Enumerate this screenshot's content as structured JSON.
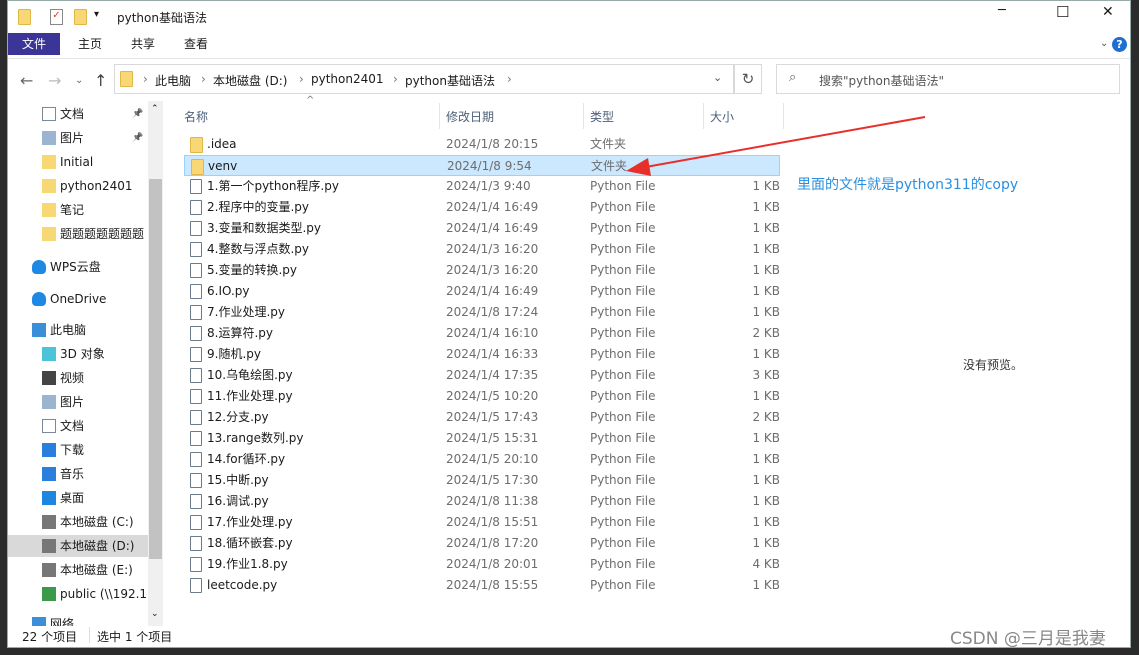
{
  "window": {
    "title": "python基础语法",
    "minimize": "─",
    "maximize": "☐",
    "close": "✕"
  },
  "ribbon": {
    "tabs": [
      "文件",
      "主页",
      "共享",
      "查看"
    ],
    "active": 0,
    "accent": "#3a3596"
  },
  "address": {
    "segments": [
      "此电脑",
      "本地磁盘 (D:)",
      "python2401",
      "python基础语法"
    ],
    "search_placeholder": "搜索\"python基础语法\""
  },
  "sidebar": {
    "items": [
      {
        "label": "文档",
        "icon": "document-icon",
        "pinned": true
      },
      {
        "label": "图片",
        "icon": "pictures-icon",
        "pinned": true
      },
      {
        "label": "Initial",
        "icon": "folder-icon"
      },
      {
        "label": "python2401",
        "icon": "folder-icon"
      },
      {
        "label": "笔记",
        "icon": "folder-icon"
      },
      {
        "label": "题题题题题题题",
        "icon": "folder-icon"
      },
      {
        "label": "WPS云盘",
        "icon": "cloud-icon"
      },
      {
        "label": "OneDrive",
        "icon": "cloud-icon"
      },
      {
        "label": "此电脑",
        "icon": "computer-icon"
      },
      {
        "label": "3D 对象",
        "icon": "cube-icon"
      },
      {
        "label": "视频",
        "icon": "video-icon"
      },
      {
        "label": "图片",
        "icon": "pictures-icon"
      },
      {
        "label": "文档",
        "icon": "document-icon"
      },
      {
        "label": "下载",
        "icon": "download-icon"
      },
      {
        "label": "音乐",
        "icon": "music-icon"
      },
      {
        "label": "桌面",
        "icon": "desktop-icon"
      },
      {
        "label": "本地磁盘 (C:)",
        "icon": "drive-icon"
      },
      {
        "label": "本地磁盘 (D:)",
        "icon": "drive-icon",
        "selected": true
      },
      {
        "label": "本地磁盘 (E:)",
        "icon": "drive-icon"
      },
      {
        "label": "public (\\\\192.1(",
        "icon": "network-drive-icon"
      },
      {
        "label": "网络",
        "icon": "network-icon"
      }
    ]
  },
  "columns": {
    "name": "名称",
    "date": "修改日期",
    "type": "类型",
    "size": "大小"
  },
  "files": [
    {
      "name": ".idea",
      "date": "2024/1/8 20:15",
      "type": "文件夹",
      "size": "",
      "folder": true
    },
    {
      "name": "venv",
      "date": "2024/1/8 9:54",
      "type": "文件夹",
      "size": "",
      "folder": true,
      "selected": true
    },
    {
      "name": "1.第一个python程序.py",
      "date": "2024/1/3 9:40",
      "type": "Python File",
      "size": "1 KB"
    },
    {
      "name": "2.程序中的变量.py",
      "date": "2024/1/4 16:49",
      "type": "Python File",
      "size": "1 KB"
    },
    {
      "name": "3.变量和数据类型.py",
      "date": "2024/1/4 16:49",
      "type": "Python File",
      "size": "1 KB"
    },
    {
      "name": "4.整数与浮点数.py",
      "date": "2024/1/3 16:20",
      "type": "Python File",
      "size": "1 KB"
    },
    {
      "name": "5.变量的转换.py",
      "date": "2024/1/3 16:20",
      "type": "Python File",
      "size": "1 KB"
    },
    {
      "name": "6.IO.py",
      "date": "2024/1/4 16:49",
      "type": "Python File",
      "size": "1 KB"
    },
    {
      "name": "7.作业处理.py",
      "date": "2024/1/8 17:24",
      "type": "Python File",
      "size": "1 KB"
    },
    {
      "name": "8.运算符.py",
      "date": "2024/1/4 16:10",
      "type": "Python File",
      "size": "2 KB"
    },
    {
      "name": "9.随机.py",
      "date": "2024/1/4 16:33",
      "type": "Python File",
      "size": "1 KB"
    },
    {
      "name": "10.乌龟绘图.py",
      "date": "2024/1/4 17:35",
      "type": "Python File",
      "size": "3 KB"
    },
    {
      "name": "11.作业处理.py",
      "date": "2024/1/5 10:20",
      "type": "Python File",
      "size": "1 KB"
    },
    {
      "name": "12.分支.py",
      "date": "2024/1/5 17:43",
      "type": "Python File",
      "size": "2 KB"
    },
    {
      "name": "13.range数列.py",
      "date": "2024/1/5 15:31",
      "type": "Python File",
      "size": "1 KB"
    },
    {
      "name": "14.for循环.py",
      "date": "2024/1/5 20:10",
      "type": "Python File",
      "size": "1 KB"
    },
    {
      "name": "15.中断.py",
      "date": "2024/1/5 17:30",
      "type": "Python File",
      "size": "1 KB"
    },
    {
      "name": "16.调试.py",
      "date": "2024/1/8 11:38",
      "type": "Python File",
      "size": "1 KB"
    },
    {
      "name": "17.作业处理.py",
      "date": "2024/1/8 15:51",
      "type": "Python File",
      "size": "1 KB"
    },
    {
      "name": "18.循环嵌套.py",
      "date": "2024/1/8 17:20",
      "type": "Python File",
      "size": "1 KB"
    },
    {
      "name": "19.作业1.8.py",
      "date": "2024/1/8 20:01",
      "type": "Python File",
      "size": "4 KB"
    },
    {
      "name": "leetcode.py",
      "date": "2024/1/8 15:55",
      "type": "Python File",
      "size": "1 KB"
    }
  ],
  "preview": {
    "empty_text": "没有预览。"
  },
  "annotation": {
    "text": "里面的文件就是python311的copy",
    "color": "#2a8fe0",
    "arrow_color": "#e8302a"
  },
  "status": {
    "count": "22 个项目",
    "selected": "选中 1 个项目"
  },
  "watermark": "CSDN @三月是我妻"
}
